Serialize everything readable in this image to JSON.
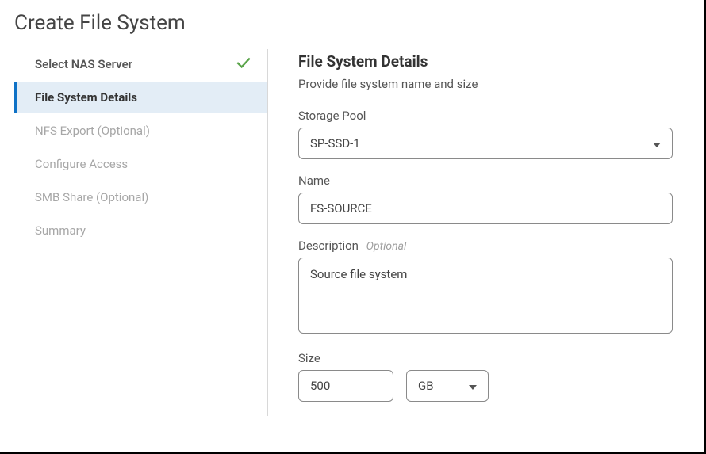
{
  "page": {
    "title": "Create File System"
  },
  "sidebar": {
    "items": [
      {
        "label": "Select NAS Server",
        "state": "completed"
      },
      {
        "label": "File System Details",
        "state": "active"
      },
      {
        "label": "NFS Export (Optional)",
        "state": "pending"
      },
      {
        "label": "Configure Access",
        "state": "pending"
      },
      {
        "label": "SMB Share (Optional)",
        "state": "pending"
      },
      {
        "label": "Summary",
        "state": "pending"
      }
    ]
  },
  "details": {
    "heading": "File System Details",
    "subheading": "Provide file system name and size",
    "storage_pool": {
      "label": "Storage Pool",
      "value": "SP-SSD-1"
    },
    "name": {
      "label": "Name",
      "value": "FS-SOURCE"
    },
    "description": {
      "label": "Description",
      "optional_text": "Optional",
      "value": "Source file system"
    },
    "size": {
      "label": "Size",
      "value": "500",
      "unit": "GB"
    }
  }
}
